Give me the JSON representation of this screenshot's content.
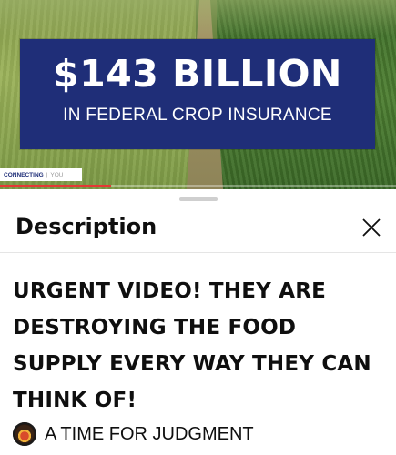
{
  "video": {
    "banner_amount": "$143 BILLION",
    "banner_subtitle": "IN FEDERAL CROP INSURANCE",
    "ticker_primary": "CONNECTING",
    "ticker_secondary": "YOU",
    "progress_fraction": 0.28,
    "colors": {
      "banner": "#1f2e78",
      "progress": "#e53935"
    }
  },
  "sheet": {
    "title": "Description",
    "close_icon": "close-icon",
    "video_title": "URGENT VIDEO! THEY ARE DESTROYING THE FOOD SUPPLY EVERY WAY THEY CAN THINK OF!",
    "channel_name": "A TIME FOR JUDGMENT",
    "channel_icon": "channel-avatar"
  }
}
